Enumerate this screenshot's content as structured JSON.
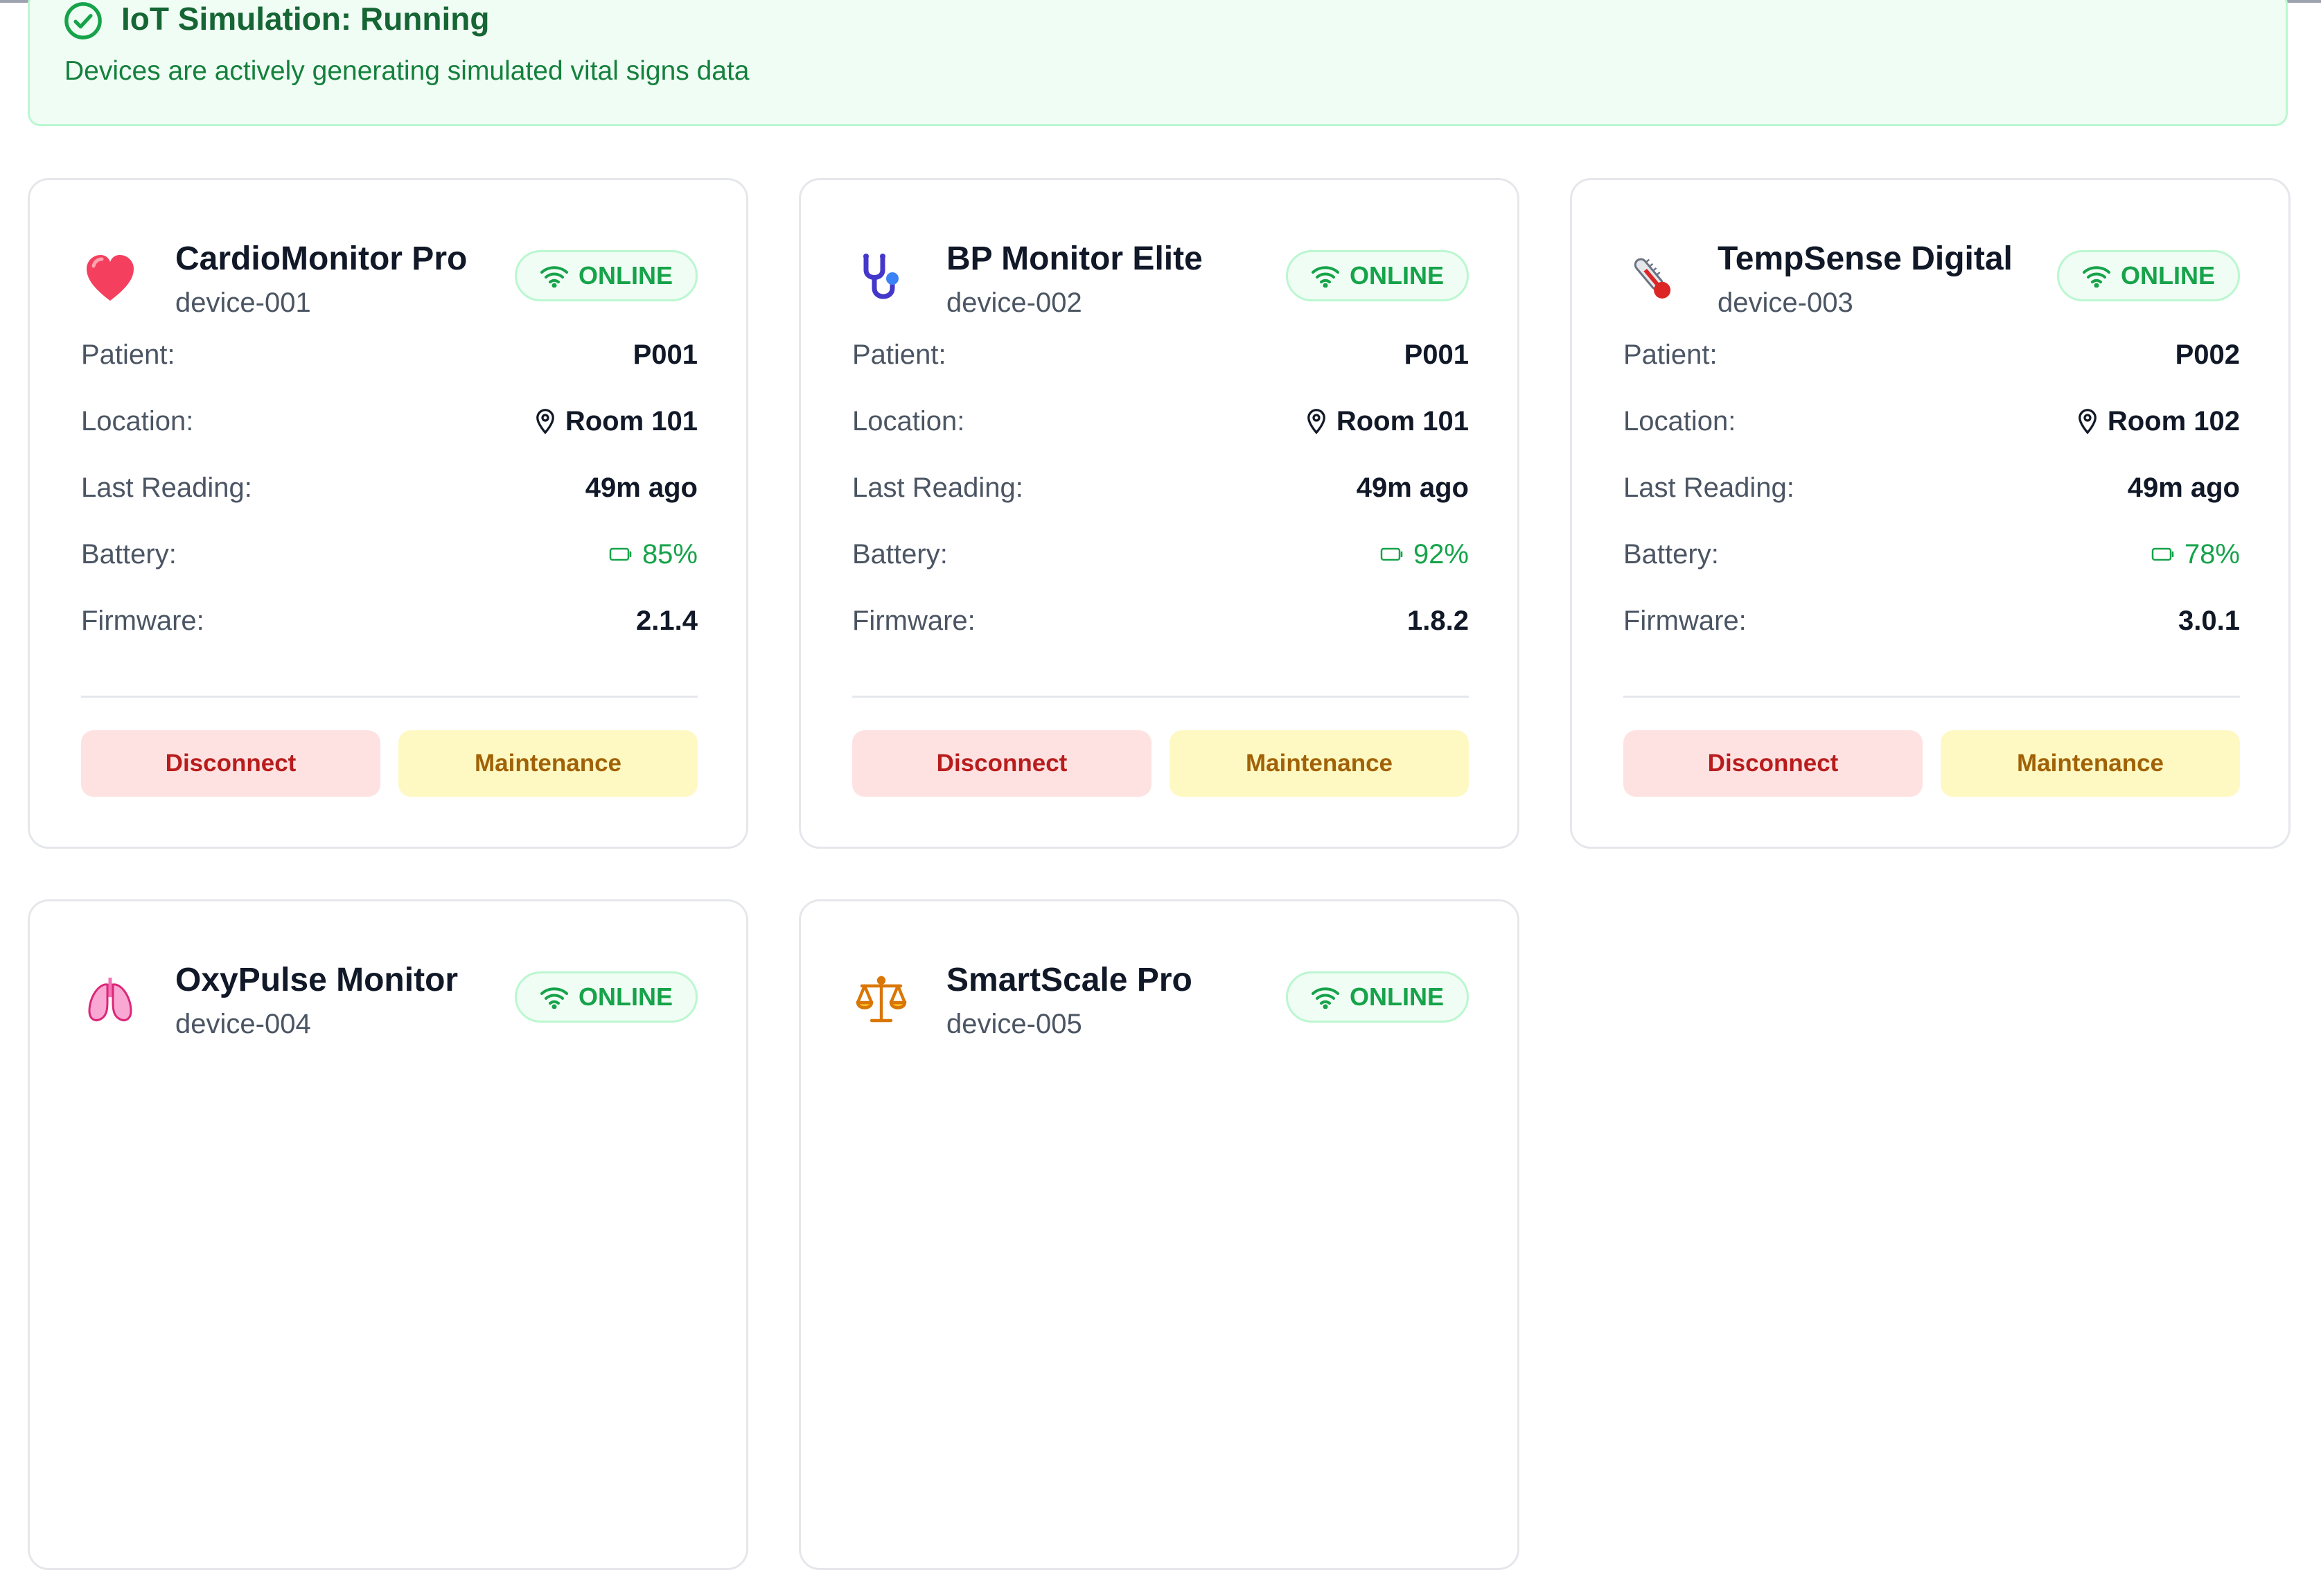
{
  "banner": {
    "title": "IoT Simulation: Running",
    "description": "Devices are actively generating simulated vital signs data"
  },
  "labels": {
    "patient": "Patient:",
    "location": "Location:",
    "last_reading": "Last Reading:",
    "battery": "Battery:",
    "firmware": "Firmware:",
    "disconnect": "Disconnect",
    "maintenance": "Maintenance"
  },
  "colors": {
    "online_green": "#16a34a",
    "banner_bg": "#f0fdf4",
    "disconnect_bg": "#fee2e2",
    "disconnect_text": "#b91c1c",
    "maintenance_bg": "#fef9c3",
    "maintenance_text": "#a16207"
  },
  "devices": [
    {
      "icon": "heart-icon",
      "name": "CardioMonitor Pro",
      "id": "device-001",
      "status": "ONLINE",
      "patient": "P001",
      "location": "Room 101",
      "last_reading": "49m ago",
      "battery": "85%",
      "firmware": "2.1.4"
    },
    {
      "icon": "stethoscope-icon",
      "name": "BP Monitor Elite",
      "id": "device-002",
      "status": "ONLINE",
      "patient": "P001",
      "location": "Room 101",
      "last_reading": "49m ago",
      "battery": "92%",
      "firmware": "1.8.2"
    },
    {
      "icon": "thermometer-icon",
      "name": "TempSense Digital",
      "id": "device-003",
      "status": "ONLINE",
      "patient": "P002",
      "location": "Room 102",
      "last_reading": "49m ago",
      "battery": "78%",
      "firmware": "3.0.1"
    },
    {
      "icon": "lungs-icon",
      "name": "OxyPulse Monitor",
      "id": "device-004",
      "status": "ONLINE"
    },
    {
      "icon": "scale-icon",
      "name": "SmartScale Pro",
      "id": "device-005",
      "status": "ONLINE"
    }
  ]
}
